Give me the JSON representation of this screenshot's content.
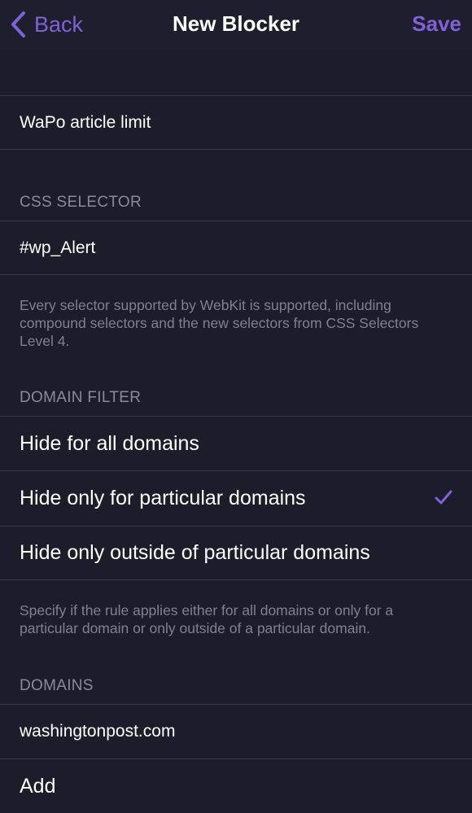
{
  "nav": {
    "back_label": "Back",
    "title": "New Blocker",
    "save_label": "Save"
  },
  "name_field": {
    "value": "WaPo article limit"
  },
  "css_selector": {
    "header": "CSS SELECTOR",
    "value": "#wp_Alert",
    "footer": "Every selector supported by WebKit is supported, including compound selectors and the new selectors from CSS Selectors Level 4."
  },
  "domain_filter": {
    "header": "DOMAIN FILTER",
    "options": [
      {
        "label": "Hide for all domains",
        "selected": false
      },
      {
        "label": "Hide only for particular domains",
        "selected": true
      },
      {
        "label": "Hide only outside of particular domains",
        "selected": false
      }
    ],
    "footer": "Specify if the rule applies either for all domains or only for a particular domain or only outside of a particular domain."
  },
  "domains": {
    "header": "DOMAINS",
    "items": [
      "washingtonpost.com"
    ],
    "add_label": "Add"
  },
  "colors": {
    "accent": "#7e62d6",
    "background": "#1c1c2b",
    "separator": "#3a3a4a",
    "secondary_text": "#8a8a98"
  }
}
